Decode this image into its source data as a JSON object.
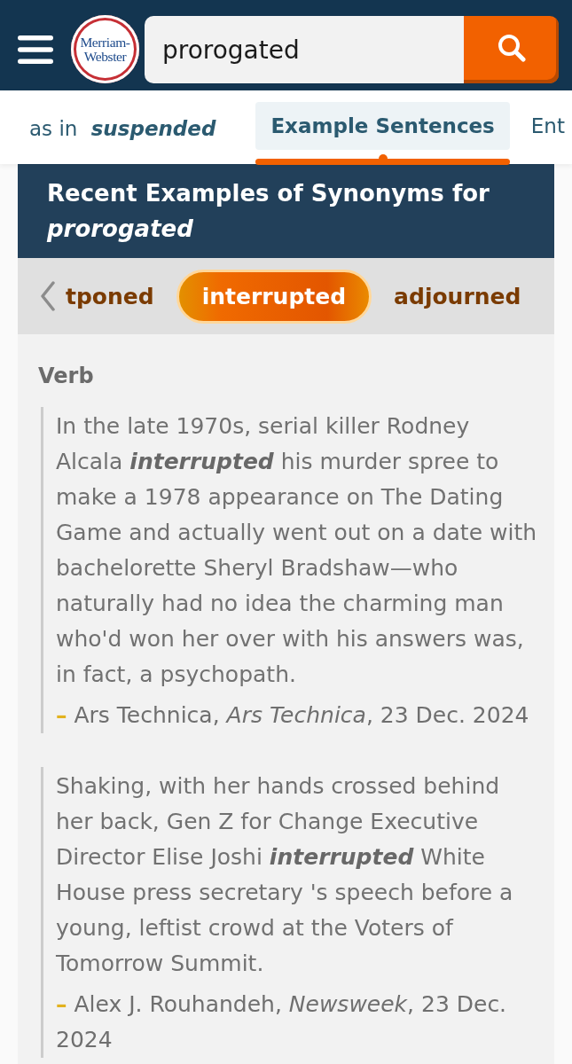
{
  "header": {
    "logo": "Merriam-Webster",
    "search": {
      "value": "prorogated"
    }
  },
  "nav": {
    "sense": {
      "prefix": "as in",
      "word": "suspended"
    },
    "tabs": [
      {
        "label": "Example Sentences",
        "selected": true
      },
      {
        "label": "Ent",
        "selected": false
      }
    ]
  },
  "section": {
    "title": "Recent Examples of Synonyms for *prorogated*",
    "synonyms": [
      {
        "label": "tponed",
        "selected": false
      },
      {
        "label": "interrupted",
        "selected": true
      },
      {
        "label": "adjourned",
        "selected": false
      }
    ],
    "part_of_speech": "Verb",
    "examples": [
      {
        "text": "In the late 1970s, serial killer Rodney Alcala **interrupted** his murder spree to make a 1978 appearance on The Dating Game and actually went out on a date with bachelorette Sheryl Bradshaw—who naturally had no idea the charming man who'd won her over with his answers was, in fact, a psychopath.",
        "dash": "–",
        "source": "Ars Technica, *Ars Technica*, 23 Dec. 2024"
      },
      {
        "text": "Shaking, with her hands crossed behind her back, Gen Z for Change Executive Director Elise Joshi **interrupted** White House press secretary 's speech before a young, leftist crowd at the Voters of Tomorrow Summit.",
        "dash": "–",
        "source": "Alex J. Rouhandeh, *Newsweek*, 23 Dec. 2024"
      }
    ]
  }
}
